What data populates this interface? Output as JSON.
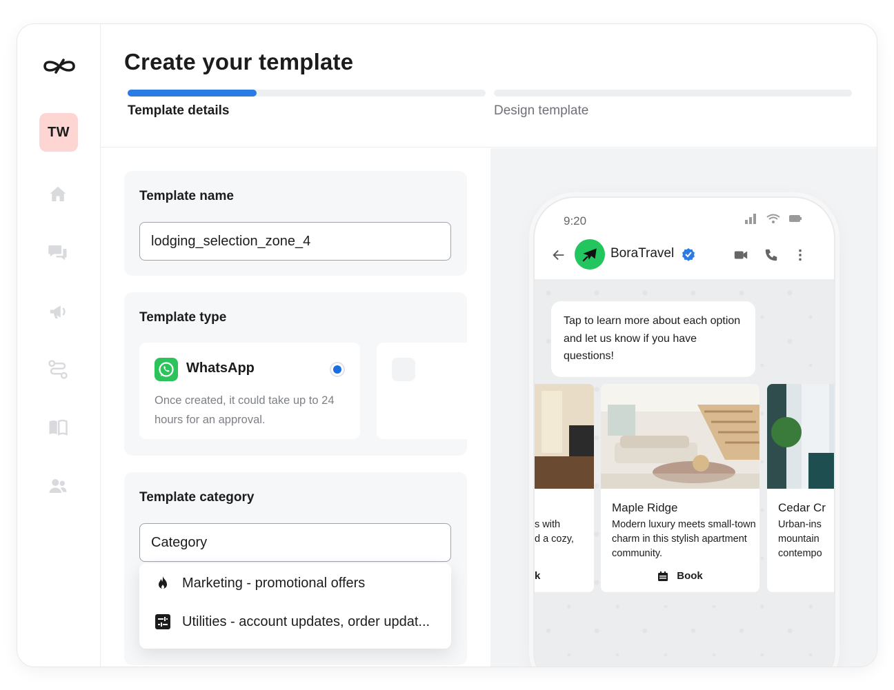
{
  "app": {
    "avatar_initials": "TW",
    "nav_icons": [
      "home-icon",
      "chat-icon",
      "megaphone-icon",
      "flow-icon",
      "book-icon",
      "users-icon"
    ]
  },
  "header": {
    "title": "Create your template",
    "steps": [
      {
        "label": "Template details",
        "active": true,
        "progress": 0.36
      },
      {
        "label": "Design template",
        "active": false,
        "progress": 0
      }
    ]
  },
  "template_name": {
    "label": "Template name",
    "value": "lodging_selection_zone_4"
  },
  "template_type": {
    "label": "Template type",
    "option": {
      "title": "WhatsApp",
      "description": "Once created, it could take up to 24 hours for an approval.",
      "selected": true
    }
  },
  "template_category": {
    "label": "Template category",
    "placeholder": "Category",
    "options": [
      {
        "icon": "flame-icon",
        "label": "Marketing - promotional offers"
      },
      {
        "icon": "sliders-icon",
        "label": "Utilities - account updates, order updat..."
      }
    ]
  },
  "preview": {
    "status_time": "9:20",
    "contact_name": "BoraTravel",
    "message": "Tap to learn more about each option and let us know if you have questions!",
    "cards": [
      {
        "title": "",
        "description": "...s with ...d a cozy,",
        "button": "...k"
      },
      {
        "title": "Maple Ridge",
        "description": "Modern luxury meets small-town charm in this stylish apartment community.",
        "button": "Book"
      },
      {
        "title": "Cedar Cr",
        "description": "Urban-ins mountain contempo",
        "button": ""
      }
    ]
  },
  "colors": {
    "accent": "#2a7be4",
    "avatar_bg": "#fdd6d3",
    "whatsapp_green": "#2cc35a",
    "radio_blue": "#1a6fe0"
  }
}
